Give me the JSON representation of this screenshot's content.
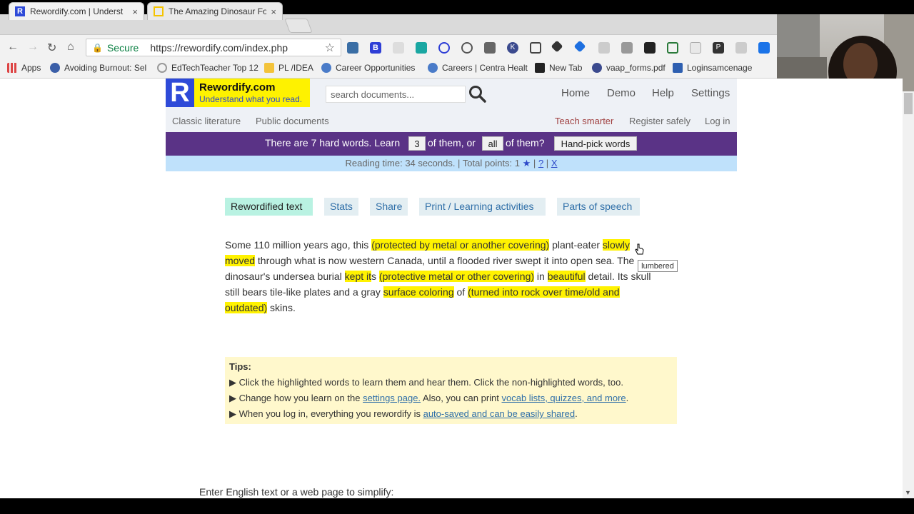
{
  "browser": {
    "tabs": [
      {
        "title": "Rewordify.com | Underst",
        "close": "×"
      },
      {
        "title": "The Amazing Dinosaur Fo",
        "close": "×"
      }
    ],
    "secure_label": "Secure",
    "url": "https://rewordify.com/index.php",
    "bookmarks": [
      {
        "label": "Apps"
      },
      {
        "label": "Avoiding Burnout: Sel"
      },
      {
        "label": "EdTechTeacher Top 12"
      },
      {
        "label": "PL /IDEA"
      },
      {
        "label": "Career Opportunities"
      },
      {
        "label": "Careers | Centra Healt"
      },
      {
        "label": "New Tab"
      },
      {
        "label": "vaap_forms.pdf"
      },
      {
        "label": "Loginsamcenage"
      }
    ]
  },
  "site": {
    "logo_letter": "R",
    "logo_title": "Rewordify.com",
    "logo_subtitle": "Understand what you read.",
    "search_placeholder": "search documents...",
    "nav": [
      "Home",
      "Demo",
      "Help",
      "Settings"
    ],
    "subnav_left": [
      "Classic literature",
      "Public documents"
    ],
    "subnav_right": [
      "Teach smarter",
      "Register safely",
      "Log in"
    ],
    "banner": {
      "part1": "There are 7 hard words. Learn",
      "count_value": "3",
      "part2": "of them, or",
      "all_value": "all",
      "part3": "of them?",
      "handpick": "Hand-pick words"
    },
    "reading": {
      "text": "Reading time: 34 seconds.  |  Total points: 1",
      "star": "★",
      "sep1": "|",
      "help": "?",
      "sep2": "|",
      "close": "X"
    },
    "tabs": [
      "Rewordified text",
      "Stats",
      "Share",
      "Print / Learning activities",
      "Parts of speech"
    ],
    "paragraph": {
      "s1": "Some 110 million years ago, this ",
      "h1": "(protected by metal or another covering)",
      "s2": " plant-eater ",
      "h2a": "slowly",
      "h2b": "moved",
      "s3": " through what is now western Canada, until a flooded river swept it into open sea. The",
      "s4": "dinosaur's undersea burial ",
      "h3": "kept it",
      "s5": "s ",
      "h4": "(protective metal or other covering)",
      "s6": " in ",
      "h5": "beautiful",
      "s7": " detail. Its skull",
      "s8": "still bears tile-like plates and a gray ",
      "h6": "surface coloring",
      "s9": " of ",
      "h7a": "(turned into rock over time/old and",
      "h7b": "outdated)",
      "s10": " skins."
    },
    "tooltip": "lumbered",
    "tips": {
      "heading": "Tips:",
      "bullet": "▶",
      "t1": "Click the highlighted words to learn them and hear them. Click the non-highlighted words, too.",
      "t2a": "Change how you learn on the ",
      "t2link": "settings page.",
      "t2b": " Also, you can print ",
      "t2link2": "vocab lists, quizzes, and more",
      "t2c": ".",
      "t3a": "When you log in, everything you rewordify is ",
      "t3link": "auto-saved and can be easily shared",
      "t3b": "."
    },
    "enter_label": "Enter English text or a web page to simplify:"
  },
  "colors": {
    "highlight": "#fff200",
    "banner": "#5a3386",
    "logo_yellow": "#fef200",
    "logo_blue": "#2e4ad8",
    "reading_bg": "#bfe1fb",
    "tips_bg": "#fff8cc"
  }
}
